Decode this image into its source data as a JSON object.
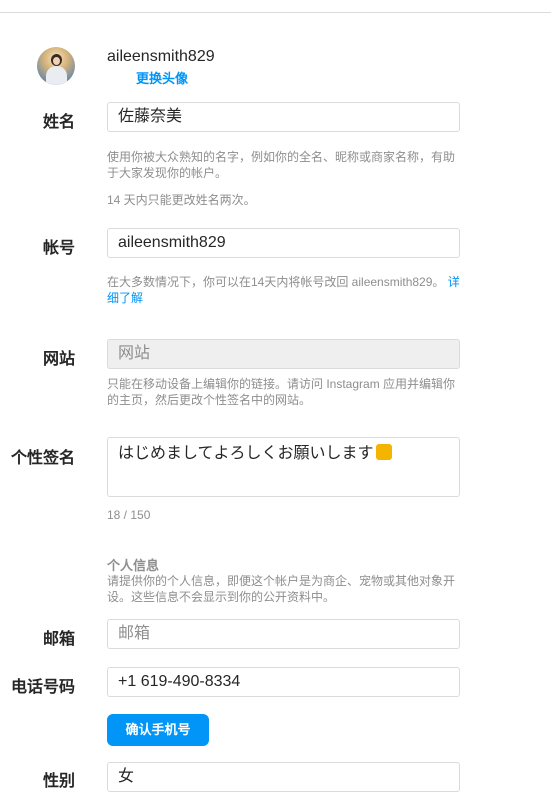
{
  "profile": {
    "username": "aileensmith829",
    "change_photo_label": "更换头像"
  },
  "fields": {
    "name": {
      "label": "姓名",
      "value": "佐藤奈美",
      "help1": "使用你被大众熟知的名字，例如你的全名、昵称或商家名称，有助于大家发现你的帐户。",
      "help2": "14 天内只能更改姓名两次。"
    },
    "account": {
      "label": "帐号",
      "value": "aileensmith829",
      "help": "在大多数情况下，你可以在14天内将帐号改回 aileensmith829。",
      "help_link": "详细了解"
    },
    "website": {
      "label": "网站",
      "placeholder": "网站",
      "help": "只能在移动设备上编辑你的链接。请访问 Instagram 应用并编辑你的主页，然后更改个性签名中的网站。"
    },
    "bio": {
      "label": "个性签名",
      "value": "はじめましてよろしくお願いします",
      "counter": "18 / 150"
    },
    "personal_info": {
      "title": "个人信息",
      "help": "请提供你的个人信息，即便这个帐户是为商企、宠物或其他对象开设。这些信息不会显示到你的公开资料中。"
    },
    "email": {
      "label": "邮箱",
      "placeholder": "邮箱"
    },
    "phone": {
      "label": "电话号码",
      "value": "+1 619-490-8334",
      "confirm_label": "确认手机号"
    },
    "gender": {
      "label": "性别",
      "value": "女"
    }
  },
  "colors": {
    "accent": "#0095f6",
    "border": "#dbdbdb",
    "muted": "#8e8e8e"
  }
}
